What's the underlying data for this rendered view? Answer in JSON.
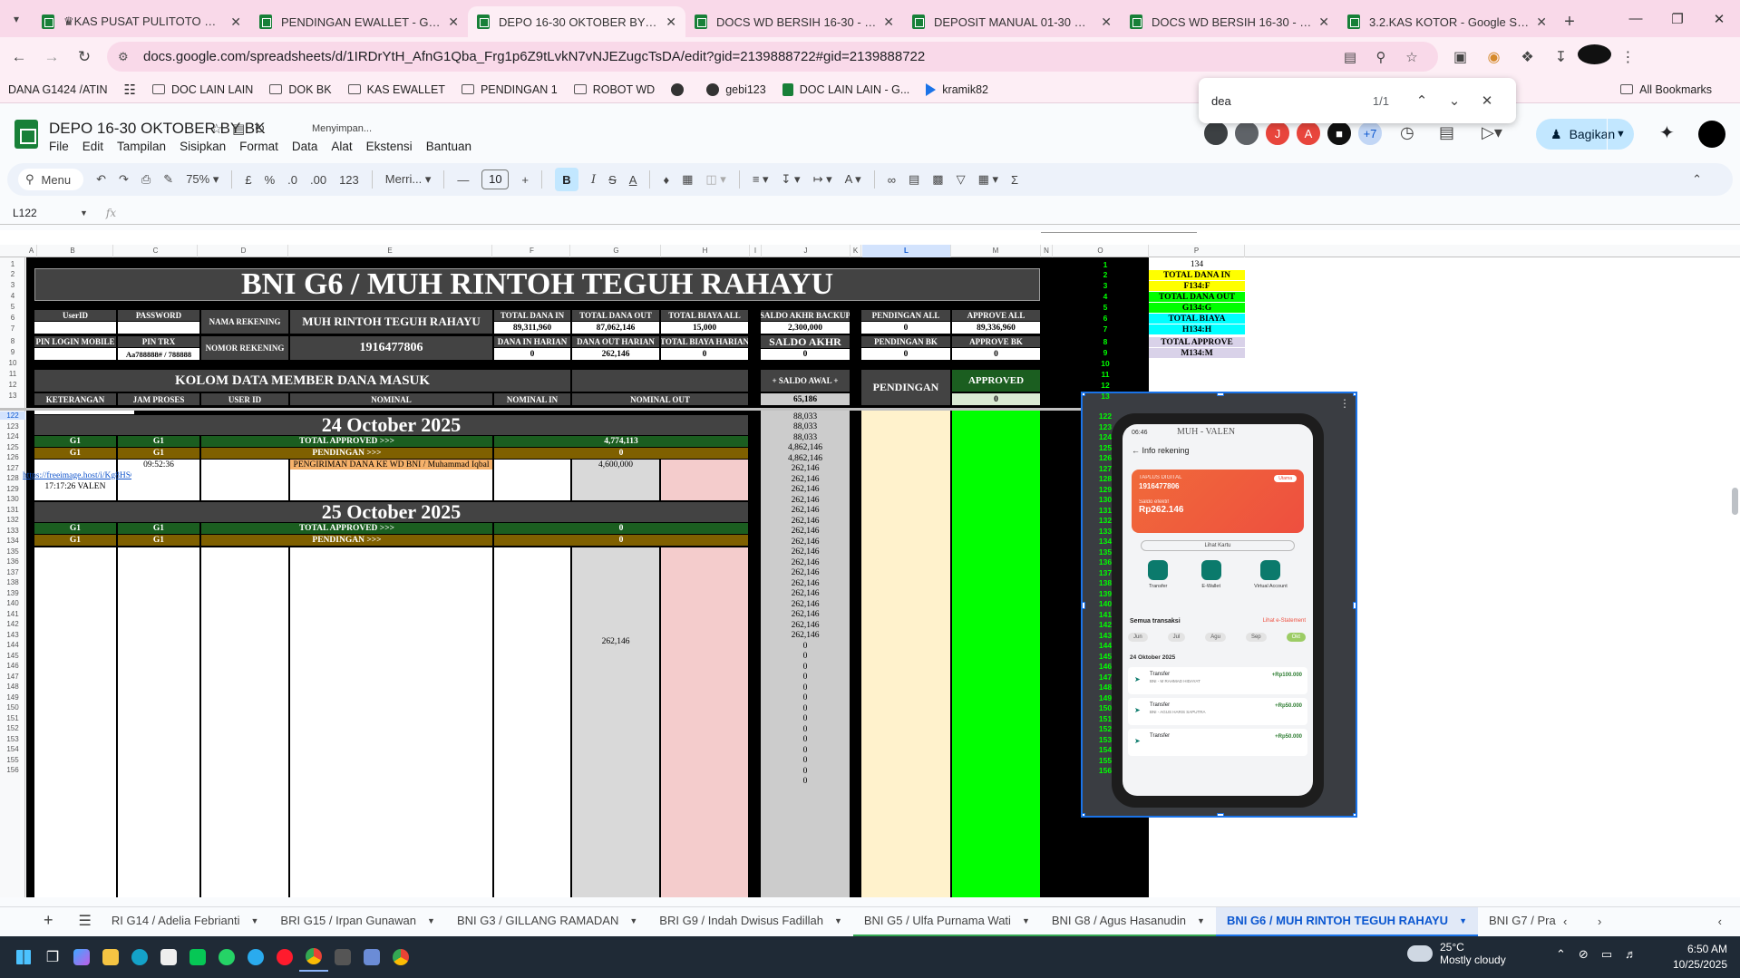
{
  "browser": {
    "tabs": [
      {
        "title": "♛KAS PUSAT PULITOTO OKTOBE",
        "active": false
      },
      {
        "title": "PENDINGAN EWALLET - Googl",
        "active": false
      },
      {
        "title": "DEPO 16-30 OKTOBER BY BK - G",
        "active": true
      },
      {
        "title": "DOCS WD BERSIH 16-30 - Goo",
        "active": false
      },
      {
        "title": "DEPOSIT MANUAL 01-30 OKTO",
        "active": false
      },
      {
        "title": "DOCS WD BERSIH 16-30 - Goo",
        "active": false
      },
      {
        "title": "3.2.KAS KOTOR - Google Sprea",
        "active": false
      }
    ],
    "url": "docs.google.com/spreadsheets/d/1IRDrYtH_AfnG1Qba_Frg1p6Z9tLvkN7vNJEZugcTsDA/edit?gid=2139888722#gid=2139888722",
    "bookmarks": [
      {
        "label": "DANA G1424 /ATIN",
        "icon": "none"
      },
      {
        "label": "",
        "icon": "apps-icon"
      },
      {
        "label": "DOC LAIN LAIN",
        "icon": "folder-icon"
      },
      {
        "label": "DOK BK",
        "icon": "folder-icon"
      },
      {
        "label": "KAS EWALLET",
        "icon": "folder-icon"
      },
      {
        "label": "PENDINGAN 1",
        "icon": "folder-icon"
      },
      {
        "label": "ROBOT WD",
        "icon": "folder-icon"
      },
      {
        "label": "",
        "icon": "globe-icon"
      },
      {
        "label": "gebi123",
        "icon": "globe-icon"
      },
      {
        "label": "DOC LAIN LAIN - G...",
        "icon": "sheets-icon"
      },
      {
        "label": "kramik82",
        "icon": "play-icon"
      }
    ],
    "all_bookmarks": "All Bookmarks"
  },
  "find": {
    "query": "dea",
    "count": "1/1"
  },
  "sheets": {
    "doc_title": "DEPO 16-30 OKTOBER BY BK",
    "saving": "Menyimpan...",
    "menus": [
      "File",
      "Edit",
      "Tampilan",
      "Sisipkan",
      "Format",
      "Data",
      "Alat",
      "Ekstensi",
      "Bantuan"
    ],
    "avatars": [
      {
        "letter": "",
        "color": "#3c4043"
      },
      {
        "letter": "",
        "color": "#5f6368"
      },
      {
        "letter": "J",
        "color": "#e8453c"
      },
      {
        "letter": "A",
        "color": "#e8453c"
      },
      {
        "letter": "■",
        "color": "#111111"
      },
      {
        "letter": "+7",
        "color": "#c2d6f5"
      }
    ],
    "share_label": "Bagikan",
    "toolbar": {
      "menu_label": "Menu",
      "zoom": "75%",
      "currency": "£",
      "percent": "%",
      "dec_minus": ".0",
      "dec_plus": ".00",
      "number_fmt": "123",
      "font": "Merri...",
      "font_size": "10"
    },
    "name_box": "L122",
    "fx": "fx"
  },
  "grid": {
    "columns": [
      "A",
      "B",
      "C",
      "D",
      "E",
      "F",
      "G",
      "H",
      "I",
      "J",
      "K",
      "L",
      "M",
      "N",
      "O",
      "P"
    ],
    "top_rows": [
      "1",
      "2",
      "3",
      "4",
      "5",
      "6",
      "7",
      "8",
      "9",
      "10",
      "11",
      "12",
      "13"
    ],
    "bottom_rows": [
      "122",
      "123",
      "124",
      "125",
      "126",
      "127",
      "128",
      "129",
      "130",
      "131",
      "132",
      "133",
      "134",
      "135",
      "136",
      "137",
      "138",
      "139",
      "140",
      "141",
      "142",
      "143",
      "144",
      "145",
      "146",
      "147",
      "148",
      "149",
      "150",
      "151",
      "152",
      "153",
      "154",
      "155",
      "156"
    ],
    "title": "BNI G6 / MUH RINTOH TEGUH RAHAYU",
    "userid_label": "UserID",
    "password_label": "PASSWORD",
    "nama_rekening_label": "NAMA REKENING",
    "nama_rekening": "MUH RINTOH TEGUH RAHAYU",
    "pin_login_label": "PIN LOGIN MOBILE",
    "pin_trx_label": "PIN TRX",
    "pin_trx": "Aa788888# / 788888",
    "nomor_rekening_label": "NOMOR REKENING",
    "nomor_rekening": "1916477806",
    "total_dana_in_label": "TOTAL DANA IN",
    "total_dana_in": "89,311,960",
    "total_dana_out_label": "TOTAL DANA OUT",
    "total_dana_out": "87,062,146",
    "total_biaya_all_label": "TOTAL BIAYA ALL",
    "total_biaya_all": "15,000",
    "dana_in_harian_label": "DANA IN HARIAN",
    "dana_in_harian": "0",
    "dana_out_harian_label": "DANA OUT HARIAN",
    "dana_out_harian": "262,146",
    "total_biaya_harian_label": "TOTAL BIAYA HARIAN",
    "total_biaya_harian": "0",
    "saldo_akhir_backup_label": "SALDO AKHR BACKUP",
    "saldo_akhir_backup": "2,300,000",
    "saldo_akhir_label": "SALDO AKHR",
    "saldo_akhir": "0",
    "pendingan_all_label": "PENDINGAN ALL",
    "pendingan_all": "0",
    "approve_all_label": "APPROVE ALL",
    "approve_all": "89,336,960",
    "pendingan_bk_label": "PENDINGAN BK",
    "pendingan_bk": "0",
    "approve_bk_label": "APPROVE BK",
    "approve_bk": "0",
    "kolom_label": "KOLOM DATA MEMBER DANA MASUK",
    "col_keterangan": "KETERANGAN",
    "col_jam": "JAM PROSES",
    "col_userid": "USER ID",
    "col_nominal": "NOMINAL",
    "col_nominal_in": "NOMINAL IN",
    "col_nominal_out": "NOMINAL OUT",
    "saldo_awal_label": "+ SALDO AWAL +",
    "saldo_awal": "65,186",
    "pendingan_label": "PENDINGAN",
    "approved_label": "APPROVED",
    "approved_value": "0",
    "p_col": {
      "p1": "134",
      "total_dana_in": "TOTAL DANA IN",
      "f134": "F134:F",
      "total_dana_out": "TOTAL DANA OUT",
      "g134": "G134:G",
      "total_biaya": "TOTAL BIAYA",
      "h134": "H134:H",
      "total_approve": "TOTAL APPROVE",
      "m134": "M134:M"
    },
    "link_top": "https://freeimage.host/i/Kg...",
    "date1": "24 October 2025",
    "g1": "G1",
    "total_approved_label": "TOTAL APPROVED >>>",
    "total_approved_1": "4,774,113",
    "pendingan_row_label": "PENDINGAN >>>",
    "pendingan_1": "0",
    "time1": "09:52:36",
    "pengiriman": "PENGIRIMAN DANA KE WD BNI  / Muhammad Iqbal",
    "out1": "4,600,000",
    "link2": "https://freeimage.host/i/Kg8HSCg",
    "time2": "17:17:26 VALEN",
    "date2": "25 October 2025",
    "total_approved_2": "0",
    "pendingan_2": "0",
    "out2": "262,146",
    "saldo_values": [
      "88,033",
      "88,033",
      "88,033",
      "4,862,146",
      "4,862,146",
      "262,146",
      "262,146",
      "262,146",
      "262,146",
      "262,146",
      "262,146",
      "262,146",
      "262,146",
      "262,146",
      "262,146",
      "262,146",
      "262,146",
      "262,146",
      "262,146",
      "262,146",
      "262,146",
      "262,146",
      "0",
      "0",
      "0",
      "0",
      "0",
      "0",
      "0",
      "0",
      "0",
      "0",
      "0",
      "0",
      "0",
      "0"
    ]
  },
  "phone": {
    "status": "06:46",
    "header": "Info rekening",
    "watermark": "MUH - VALEN",
    "card_label": "TAPLUS DIGITAL",
    "card_badge": "Utama",
    "account": "1916477806",
    "saldo_label": "Saldo efektif",
    "saldo": "Rp262.146",
    "lihat": "Lihat Kartu",
    "quick": [
      "Transfer",
      "E-Wallet",
      "Virtual Account"
    ],
    "semua": "Semua transaksi",
    "lihat_mutasi": "Lihat e-Statement",
    "months": [
      "Jun",
      "Jul",
      "Agu",
      "Sep",
      "Okt"
    ],
    "tx_date": "24 Oktober 2025",
    "txs": [
      {
        "label": "Transfer",
        "sub": "BNI - M RAHMAD HIDAYAT",
        "amount": "+Rp100.000"
      },
      {
        "label": "Transfer",
        "sub": "BNI - AGUS HARIS SAPUTRA",
        "amount": "+Rp50.000"
      },
      {
        "label": "Transfer",
        "sub": "",
        "amount": "+Rp50.000"
      }
    ]
  },
  "sheet_tabs": [
    {
      "label": "RI G14 / Adelia Febrianti",
      "state": "plain"
    },
    {
      "label": "BRI G15 / Irpan Gunawan",
      "state": "plain"
    },
    {
      "label": "BNI G3 / GILLANG RAMADAN",
      "state": "plain"
    },
    {
      "label": "BRI G9 / Indah Dwisus Fadillah",
      "state": "plain"
    },
    {
      "label": "BNI G5 / Ulfa Purnama Wati",
      "state": "green"
    },
    {
      "label": "BNI G8 / Agus Hasanudin",
      "state": "green"
    },
    {
      "label": "BNI G6 / MUH RINTOH TEGUH RAHAYU",
      "state": "active"
    },
    {
      "label": "BNI G7 / Pra",
      "state": "plain"
    }
  ],
  "taskbar": {
    "weather_temp": "25°C",
    "weather_desc": "Mostly cloudy",
    "time": "6:50 AM",
    "date": "10/25/2025"
  }
}
